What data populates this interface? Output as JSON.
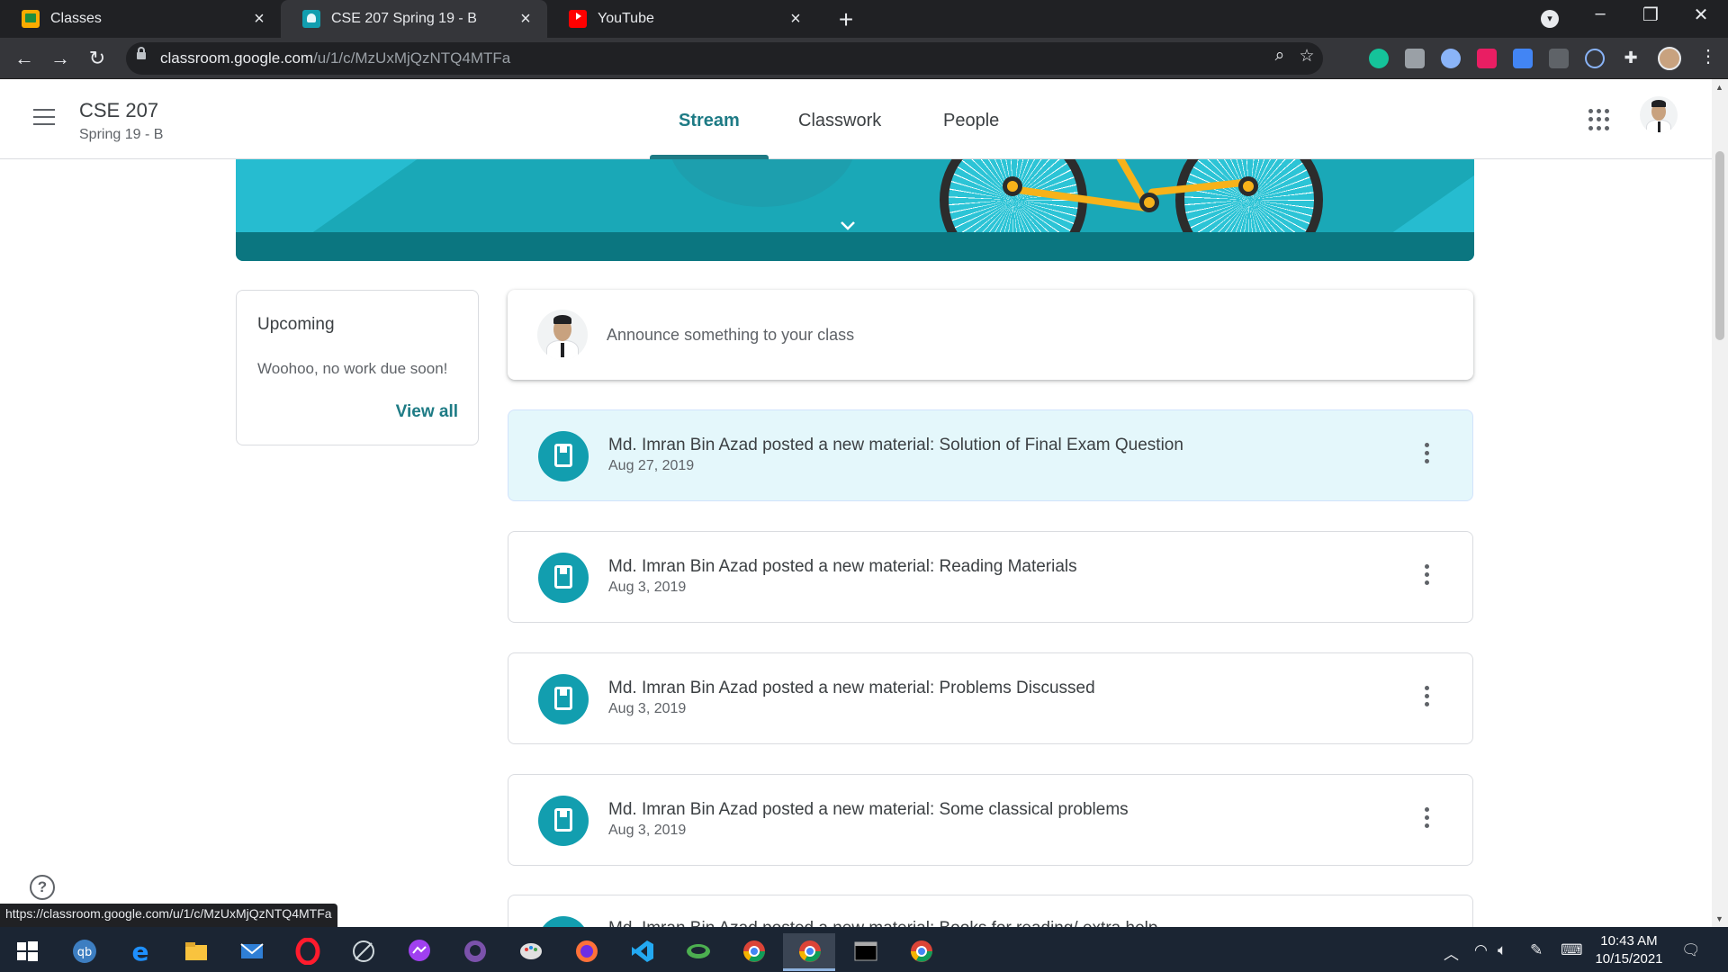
{
  "browser": {
    "tabs": [
      {
        "label": "Classes",
        "icon": "google-classroom-favicon",
        "active": false
      },
      {
        "label": "CSE 207 Spring 19 - B",
        "icon": "class-favicon",
        "active": true
      },
      {
        "label": "YouTube",
        "icon": "youtube-favicon",
        "active": false
      }
    ],
    "url_host": "classroom.google.com",
    "url_path": "/u/1/c/MzUxMjQzNTQ4MTFa",
    "status_url": "https://classroom.google.com/u/1/c/MzUxMjQzNTQ4MTFa"
  },
  "header": {
    "class_name": "CSE 207",
    "section": "Spring 19 - B",
    "tabs": [
      "Stream",
      "Classwork",
      "People"
    ],
    "active_tab": "Stream",
    "accent_color": "#1e7b85"
  },
  "upcoming": {
    "title": "Upcoming",
    "empty_text": "Woohoo, no work due soon!",
    "link": "View all"
  },
  "announce": {
    "placeholder": "Announce something to your class"
  },
  "stream": {
    "posts": [
      {
        "title": "Md. Imran Bin Azad posted a new material: Solution of Final Exam Question",
        "date": "Aug 27, 2019",
        "highlighted": true
      },
      {
        "title": "Md. Imran Bin Azad posted a new material: Reading Materials",
        "date": "Aug 3, 2019",
        "highlighted": false
      },
      {
        "title": "Md. Imran Bin Azad posted a new material: Problems Discussed",
        "date": "Aug 3, 2019",
        "highlighted": false
      },
      {
        "title": "Md. Imran Bin Azad posted a new material: Some classical problems",
        "date": "Aug 3, 2019",
        "highlighted": false
      },
      {
        "title": "Md. Imran Bin Azad posted a new material: Books for reading/ extra help",
        "date": "",
        "highlighted": false
      }
    ]
  },
  "taskbar": {
    "time": "10:43 AM",
    "date": "10/15/2021"
  }
}
